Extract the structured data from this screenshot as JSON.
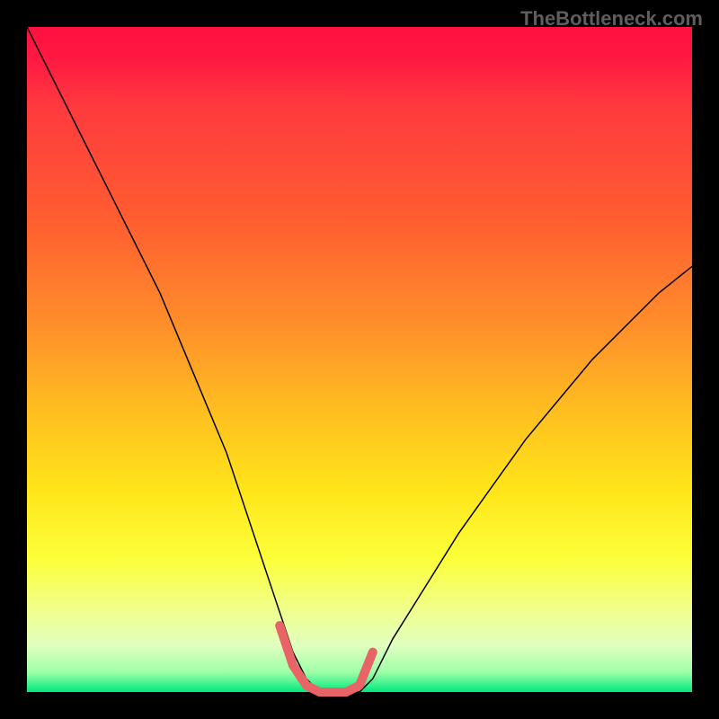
{
  "watermark": "TheBottleneck.com",
  "chart_data": {
    "type": "line",
    "title": "",
    "xlabel": "",
    "ylabel": "",
    "xlim": [
      0,
      100
    ],
    "ylim": [
      0,
      100
    ],
    "gradient_background": {
      "top_color": "#ff1040",
      "bottom_color": "#00e87e",
      "description": "Vertical gradient red→orange→yellow→green"
    },
    "series": [
      {
        "name": "main-curve",
        "color": "#000000",
        "stroke_width": 1.5,
        "x": [
          0,
          5,
          10,
          15,
          20,
          25,
          30,
          33,
          36,
          38,
          40,
          42,
          44,
          46,
          48,
          50,
          52,
          55,
          60,
          65,
          70,
          75,
          80,
          85,
          90,
          95,
          100
        ],
        "y": [
          100,
          90,
          80,
          70,
          60,
          48,
          36,
          27,
          18,
          12,
          6,
          2,
          0,
          0,
          0,
          0,
          2,
          8,
          16,
          24,
          31,
          38,
          44,
          50,
          55,
          60,
          64
        ]
      },
      {
        "name": "valley-highlight",
        "color": "#e86466",
        "stroke_width": 10,
        "x": [
          38,
          40,
          42,
          44,
          46,
          48,
          50,
          52
        ],
        "y": [
          10,
          4,
          1,
          0,
          0,
          0,
          1,
          6
        ]
      }
    ]
  }
}
